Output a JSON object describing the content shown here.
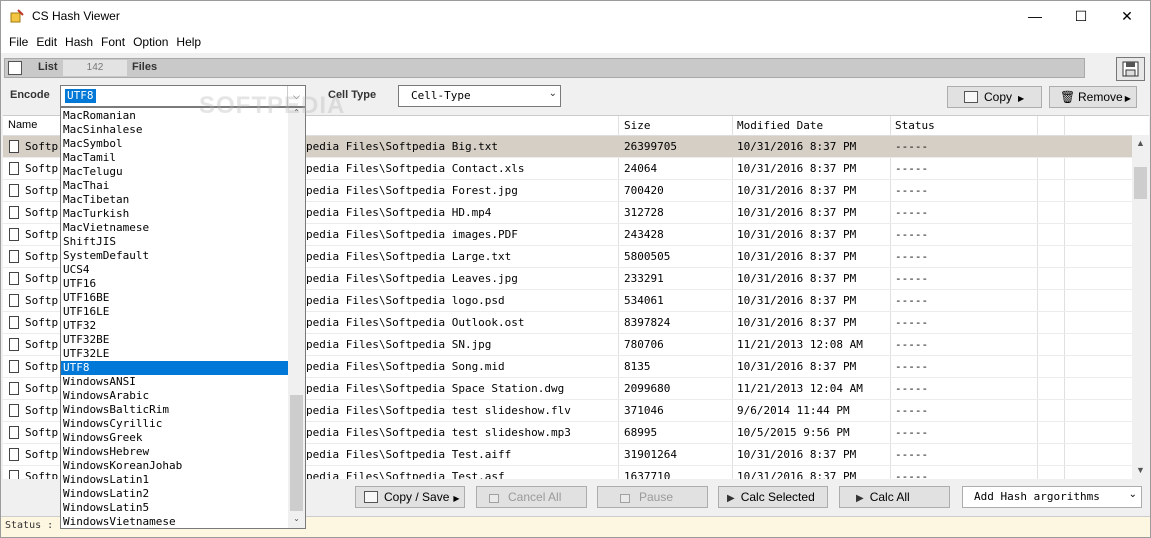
{
  "window": {
    "title": "CS Hash Viewer",
    "minimize": "—",
    "maximize": "☐",
    "close": "✕"
  },
  "menu": [
    "File",
    "Edit",
    "Hash",
    "Font",
    "Option",
    "Help"
  ],
  "listbar": {
    "label": "List",
    "count": "142",
    "files_label": "Files"
  },
  "controls": {
    "encode_label": "Encode",
    "encode_value": "UTF8",
    "celltype_label": "Cell Type",
    "celltype_value": "Cell-Type",
    "copy_label": "Copy",
    "remove_label": "Remove"
  },
  "table": {
    "columns": [
      "Name",
      "Size",
      "Modified Date",
      "Status"
    ],
    "rows": [
      {
        "name": "Softpedia Files\\Softpedia Big.txt",
        "name_prefix": "Softp",
        "path": "pedia Files\\Softpedia Big.txt",
        "size": "26399705",
        "date": "10/31/2016 8:37 PM",
        "status": "-----"
      },
      {
        "name_prefix": "Softp",
        "path": "pedia Files\\Softpedia Contact.xls",
        "size": "24064",
        "date": "10/31/2016 8:37 PM",
        "status": "-----"
      },
      {
        "name_prefix": "Softp",
        "path": "pedia Files\\Softpedia Forest.jpg",
        "size": "700420",
        "date": "10/31/2016 8:37 PM",
        "status": "-----"
      },
      {
        "name_prefix": "Softp",
        "path": "pedia Files\\Softpedia HD.mp4",
        "size": "312728",
        "date": "10/31/2016 8:37 PM",
        "status": "-----"
      },
      {
        "name_prefix": "Softp",
        "path": "pedia Files\\Softpedia images.PDF",
        "size": "243428",
        "date": "10/31/2016 8:37 PM",
        "status": "-----"
      },
      {
        "name_prefix": "Softp",
        "path": "pedia Files\\Softpedia Large.txt",
        "size": "5800505",
        "date": "10/31/2016 8:37 PM",
        "status": "-----"
      },
      {
        "name_prefix": "Softp",
        "path": "pedia Files\\Softpedia Leaves.jpg",
        "size": "233291",
        "date": "10/31/2016 8:37 PM",
        "status": "-----"
      },
      {
        "name_prefix": "Softp",
        "path": "pedia Files\\Softpedia logo.psd",
        "size": "534061",
        "date": "10/31/2016 8:37 PM",
        "status": "-----"
      },
      {
        "name_prefix": "Softp",
        "path": "pedia Files\\Softpedia Outlook.ost",
        "size": "8397824",
        "date": "10/31/2016 8:37 PM",
        "status": "-----"
      },
      {
        "name_prefix": "Softp",
        "path": "pedia Files\\Softpedia SN.jpg",
        "size": "780706",
        "date": "11/21/2013 12:08 AM",
        "status": "-----"
      },
      {
        "name_prefix": "Softp",
        "path": "pedia Files\\Softpedia Song.mid",
        "size": "8135",
        "date": "10/31/2016 8:37 PM",
        "status": "-----"
      },
      {
        "name_prefix": "Softp",
        "path": "pedia Files\\Softpedia Space Station.dwg",
        "size": "2099680",
        "date": "11/21/2013 12:04 AM",
        "status": "-----"
      },
      {
        "name_prefix": "Softp",
        "path": "pedia Files\\Softpedia test slideshow.flv",
        "size": "371046",
        "date": "9/6/2014 11:44 PM",
        "status": "-----"
      },
      {
        "name_prefix": "Softp",
        "path": "pedia Files\\Softpedia test slideshow.mp3",
        "size": "68995",
        "date": "10/5/2015 9:56 PM",
        "status": "-----"
      },
      {
        "name_prefix": "Softp",
        "path": "pedia Files\\Softpedia Test.aiff",
        "size": "31901264",
        "date": "10/31/2016 8:37 PM",
        "status": "-----"
      },
      {
        "name_prefix": "Softp",
        "path": "pedia Files\\Softpedia Test.asf",
        "size": "1637710",
        "date": "10/31/2016 8:37 PM",
        "status": "-----"
      }
    ]
  },
  "encode_options": [
    "MacRomanian",
    "MacSinhalese",
    "MacSymbol",
    "MacTamil",
    "MacTelugu",
    "MacThai",
    "MacTibetan",
    "MacTurkish",
    "MacVietnamese",
    "ShiftJIS",
    "SystemDefault",
    "UCS4",
    "UTF16",
    "UTF16BE",
    "UTF16LE",
    "UTF32",
    "UTF32BE",
    "UTF32LE",
    "UTF8",
    "WindowsANSI",
    "WindowsArabic",
    "WindowsBalticRim",
    "WindowsCyrillic",
    "WindowsGreek",
    "WindowsHebrew",
    "WindowsKoreanJohab",
    "WindowsLatin1",
    "WindowsLatin2",
    "WindowsLatin5",
    "WindowsVietnamese"
  ],
  "encode_selected": "UTF8",
  "bottom": {
    "copysave_label": "Copy / Save",
    "cancel_label": "Cancel All",
    "pause_label": "Pause",
    "calcsel_label": "Calc Selected",
    "calcall_label": "Calc All",
    "hashalg_value": "Add Hash argorithms"
  },
  "status": {
    "label": "Status :"
  },
  "watermark": "SOFTPEDIA",
  "colors": {
    "selection": "#0078d7",
    "row_selected": "#d6cfc6",
    "statusbar": "#fdf6e0"
  }
}
